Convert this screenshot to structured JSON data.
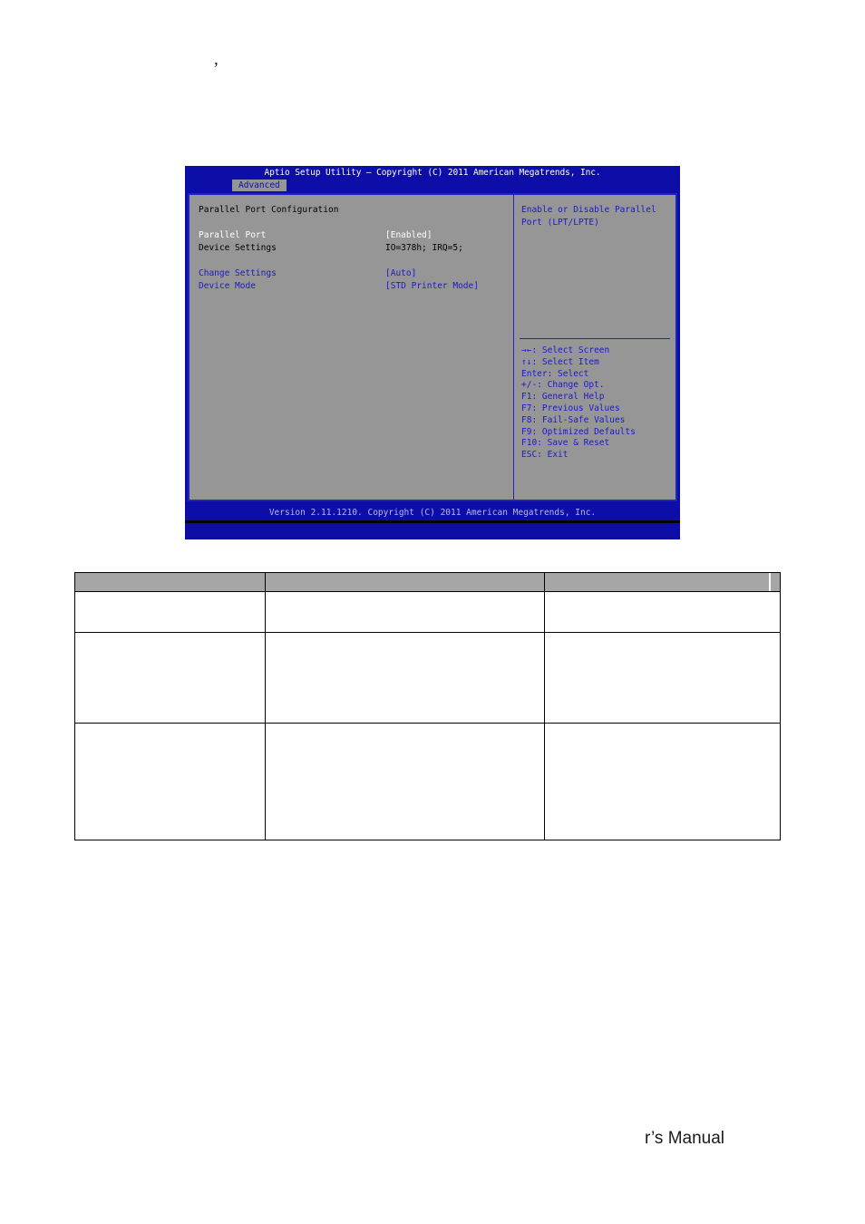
{
  "page": {
    "top_mark": ",",
    "footer_text": "r’s Manual"
  },
  "bios": {
    "title": "Aptio Setup Utility – Copyright (C) 2011 American Megatrends, Inc.",
    "active_tab": "Advanced",
    "section_title": "Parallel Port Configuration",
    "options": [
      {
        "label": "Parallel Port",
        "value": "[Enabled]",
        "color": "#ffffff"
      },
      {
        "label": "Device Settings",
        "value": "IO=378h; IRQ=5;",
        "color": "#000000"
      },
      {
        "label": "Change Settings",
        "value": "[Auto]",
        "color": "#1a1acc"
      },
      {
        "label": "Device Mode",
        "value": "[STD Printer Mode]",
        "color": "#1a1acc"
      }
    ],
    "help_lines": [
      "Enable or Disable Parallel",
      "Port (LPT/LPTE)"
    ],
    "nav_items": [
      "→←: Select Screen",
      "↑↓: Select Item",
      "Enter: Select",
      "+/-: Change Opt.",
      "F1: General Help",
      "F7: Previous Values",
      "F8: Fail-Safe Values",
      "F9: Optimized Defaults",
      "F10: Save & Reset",
      "ESC: Exit"
    ],
    "footer": "Version 2.11.1210. Copyright (C) 2011 American Megatrends, Inc."
  },
  "table": {
    "header": [
      "",
      "",
      ""
    ],
    "rows": [
      [
        "",
        "",
        ""
      ],
      [
        "",
        "",
        ""
      ],
      [
        "",
        "",
        ""
      ]
    ]
  }
}
